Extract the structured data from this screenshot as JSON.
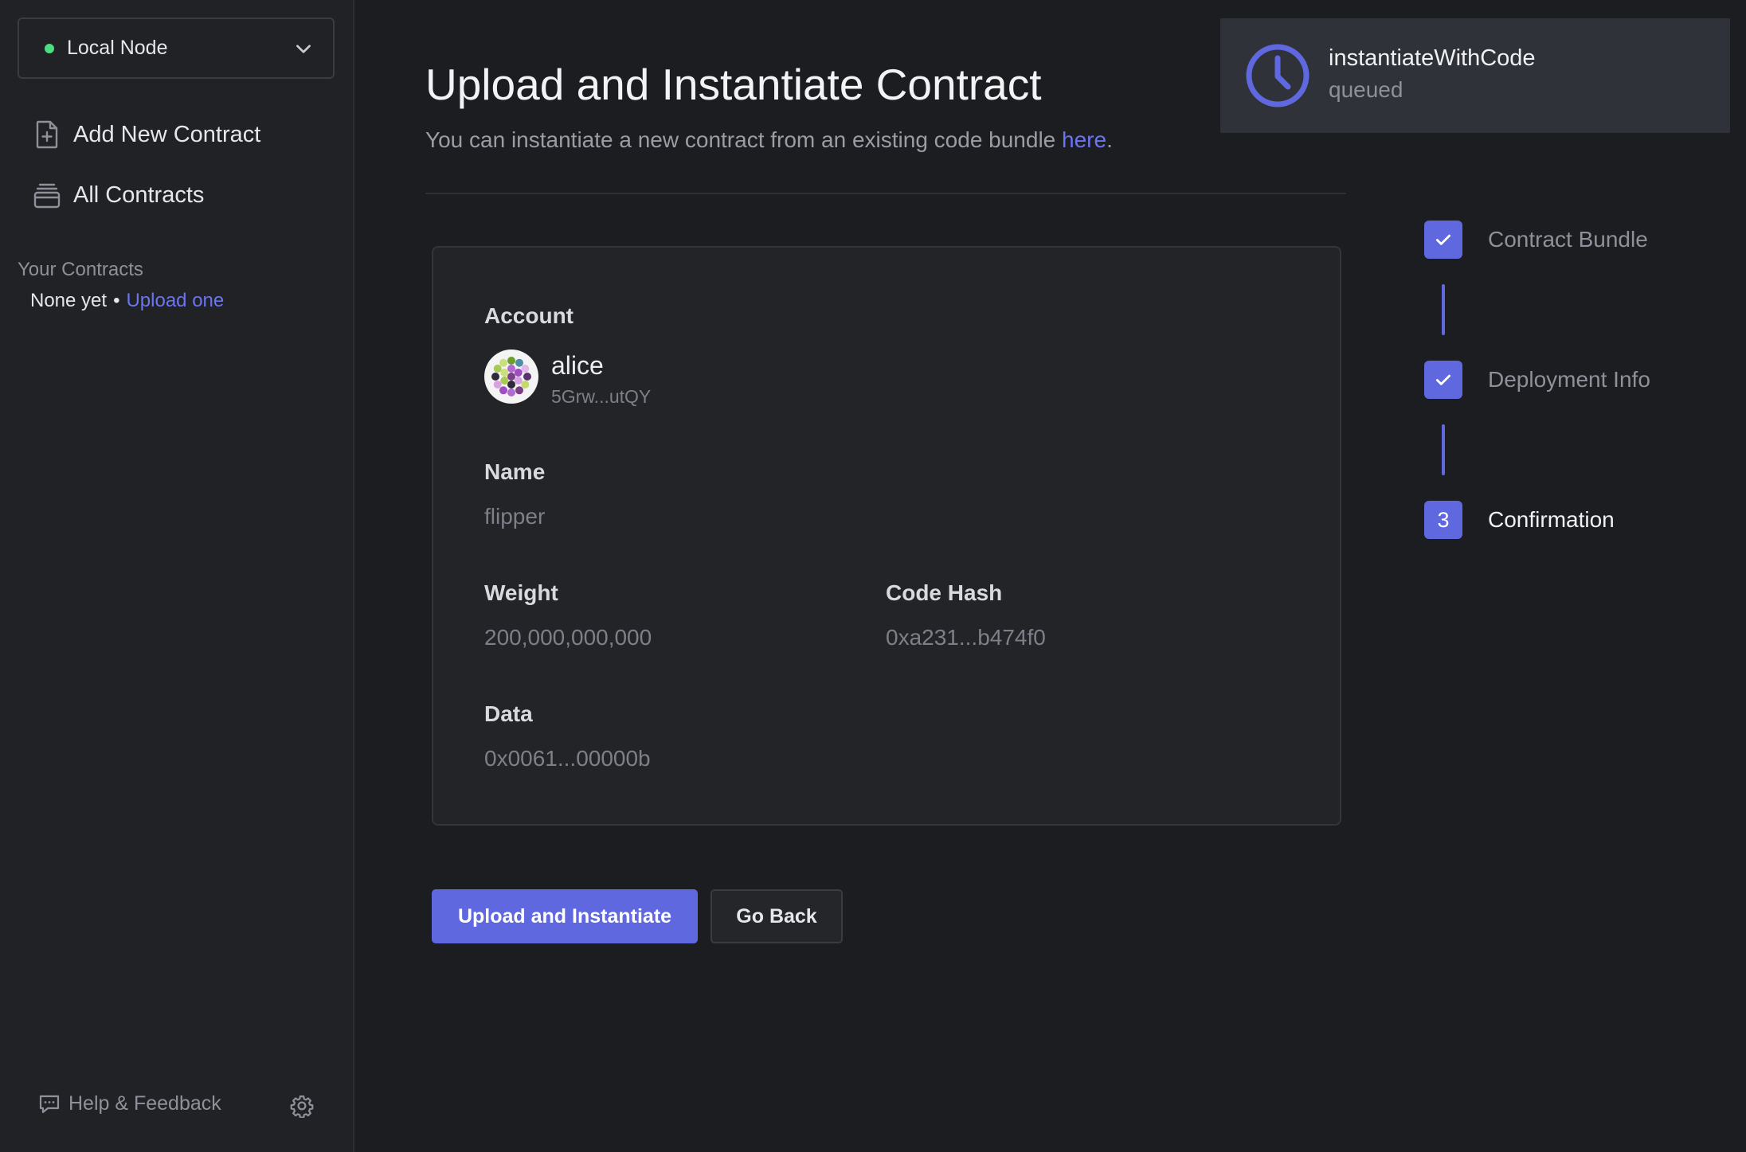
{
  "sidebar": {
    "node": {
      "label": "Local Node",
      "status_color": "#4ade80"
    },
    "nav": [
      {
        "label": "Add New Contract",
        "icon": "file-plus-icon"
      },
      {
        "label": "All Contracts",
        "icon": "stack-icon"
      }
    ],
    "your_contracts": {
      "heading": "Your Contracts",
      "empty_text": "None yet",
      "separator": "•",
      "upload_link": "Upload one"
    },
    "help_label": "Help & Feedback"
  },
  "main": {
    "title": "Upload and Instantiate Contract",
    "subtitle_text": "You can instantiate a new contract from an existing code bundle ",
    "subtitle_link": "here",
    "subtitle_end": ".",
    "card": {
      "account_label": "Account",
      "account_name": "alice",
      "account_address": "5Grw...utQY",
      "name_label": "Name",
      "name_value": "flipper",
      "weight_label": "Weight",
      "weight_value": "200,000,000,000",
      "code_hash_label": "Code Hash",
      "code_hash_value": "0xa231...b474f0",
      "data_label": "Data",
      "data_value": "0x0061...00000b"
    },
    "buttons": {
      "primary": "Upload and Instantiate",
      "secondary": "Go Back"
    }
  },
  "steps": [
    {
      "label": "Contract Bundle",
      "state": "done"
    },
    {
      "label": "Deployment Info",
      "state": "done"
    },
    {
      "label": "Confirmation",
      "state": "current",
      "number": "3"
    }
  ],
  "toast": {
    "title": "instantiateWithCode",
    "status": "queued",
    "icon": "clock-icon"
  },
  "colors": {
    "accent": "#6068e0",
    "link": "#6d74f0",
    "background": "#1c1d20",
    "sidebar": "#202226",
    "status_online": "#4ade80"
  }
}
